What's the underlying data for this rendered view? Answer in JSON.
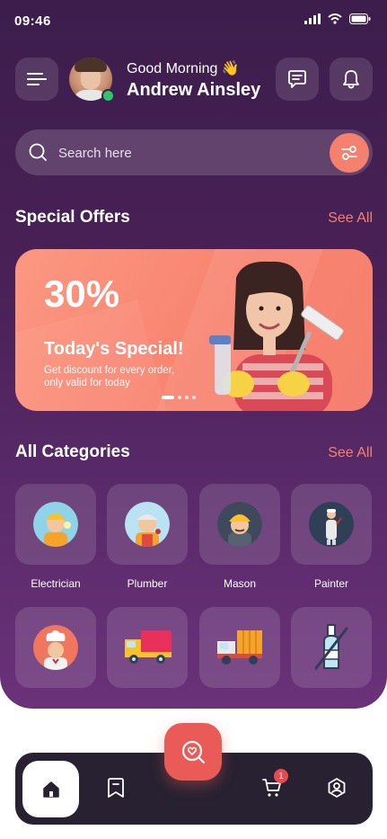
{
  "status_bar": {
    "time": "09:46"
  },
  "header": {
    "greeting": "Good Morning 👋",
    "user_name": "Andrew Ainsley"
  },
  "search": {
    "placeholder": "Search here"
  },
  "special_offers": {
    "title": "Special Offers",
    "see_all": "See All",
    "banner": {
      "discount": "30%",
      "headline": "Today's Special!",
      "description": "Get discount for every order, only valid for today"
    }
  },
  "categories": {
    "title": "All Categories",
    "see_all": "See All",
    "items": [
      {
        "label": "Electrician",
        "icon": "electrician-icon",
        "color": "#8fd3e8"
      },
      {
        "label": "Plumber",
        "icon": "plumber-icon",
        "color": "#b9e3f2"
      },
      {
        "label": "Mason",
        "icon": "mason-icon",
        "color": "#3e4a5c"
      },
      {
        "label": "Painter",
        "icon": "painter-icon",
        "color": "#2f3f55"
      },
      {
        "label": "",
        "icon": "chef-icon",
        "color": "#f0765f"
      },
      {
        "label": "",
        "icon": "delivery-truck-icon",
        "color": ""
      },
      {
        "label": "",
        "icon": "moving-truck-icon",
        "color": ""
      },
      {
        "label": "",
        "icon": "no-alcohol-icon",
        "color": ""
      }
    ]
  },
  "bottom_nav": {
    "cart_badge": "1",
    "items": [
      "home-icon",
      "bookmark-icon",
      "search-heart-icon",
      "cart-icon",
      "profile-icon"
    ]
  },
  "colors": {
    "accent": "#f4806e",
    "fab": "#ea5b58",
    "nav_bg": "#272131"
  }
}
